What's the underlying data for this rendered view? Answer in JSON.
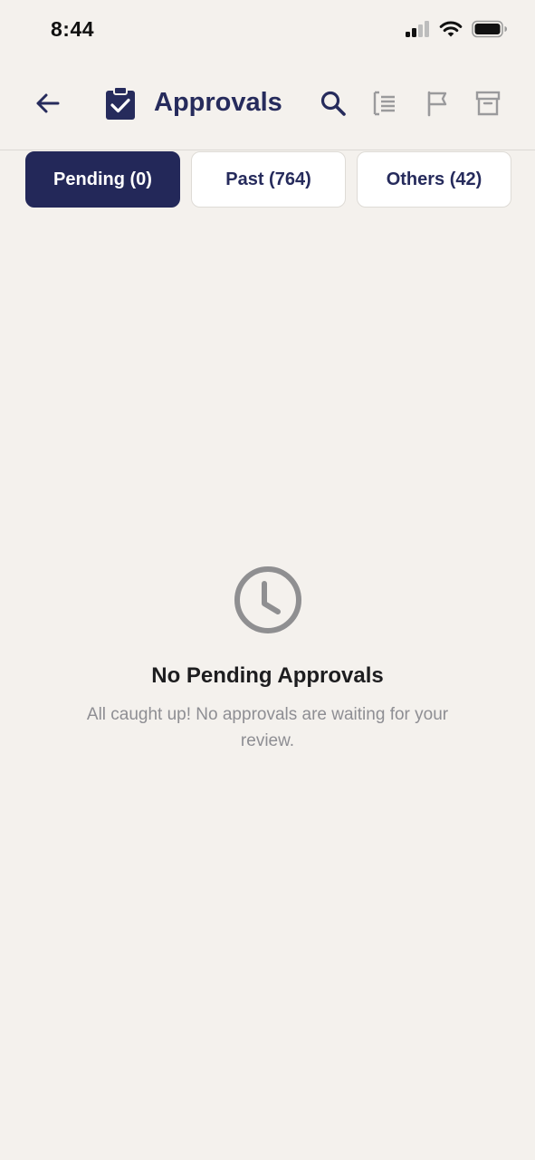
{
  "status_bar": {
    "time": "8:44",
    "icons": [
      "cellular-signal-icon",
      "wifi-icon",
      "battery-icon"
    ]
  },
  "header": {
    "back_icon": "arrow-left-icon",
    "title_icon": "clipboard-check-icon",
    "title": "Approvals",
    "actions": [
      "search-icon",
      "list-icon",
      "flag-icon",
      "archive-icon"
    ]
  },
  "tabs": [
    {
      "label": "Pending (0)",
      "active": true
    },
    {
      "label": "Past (764)",
      "active": false
    },
    {
      "label": "Others (42)",
      "active": false
    }
  ],
  "empty_state": {
    "icon": "clock-icon",
    "title": "No Pending Approvals",
    "subtitle": "All caught up! No approvals are waiting for your review."
  },
  "colors": {
    "background": "#f4f1ed",
    "accent": "#232859",
    "title": "#262b5c",
    "muted": "#8e8e93"
  }
}
